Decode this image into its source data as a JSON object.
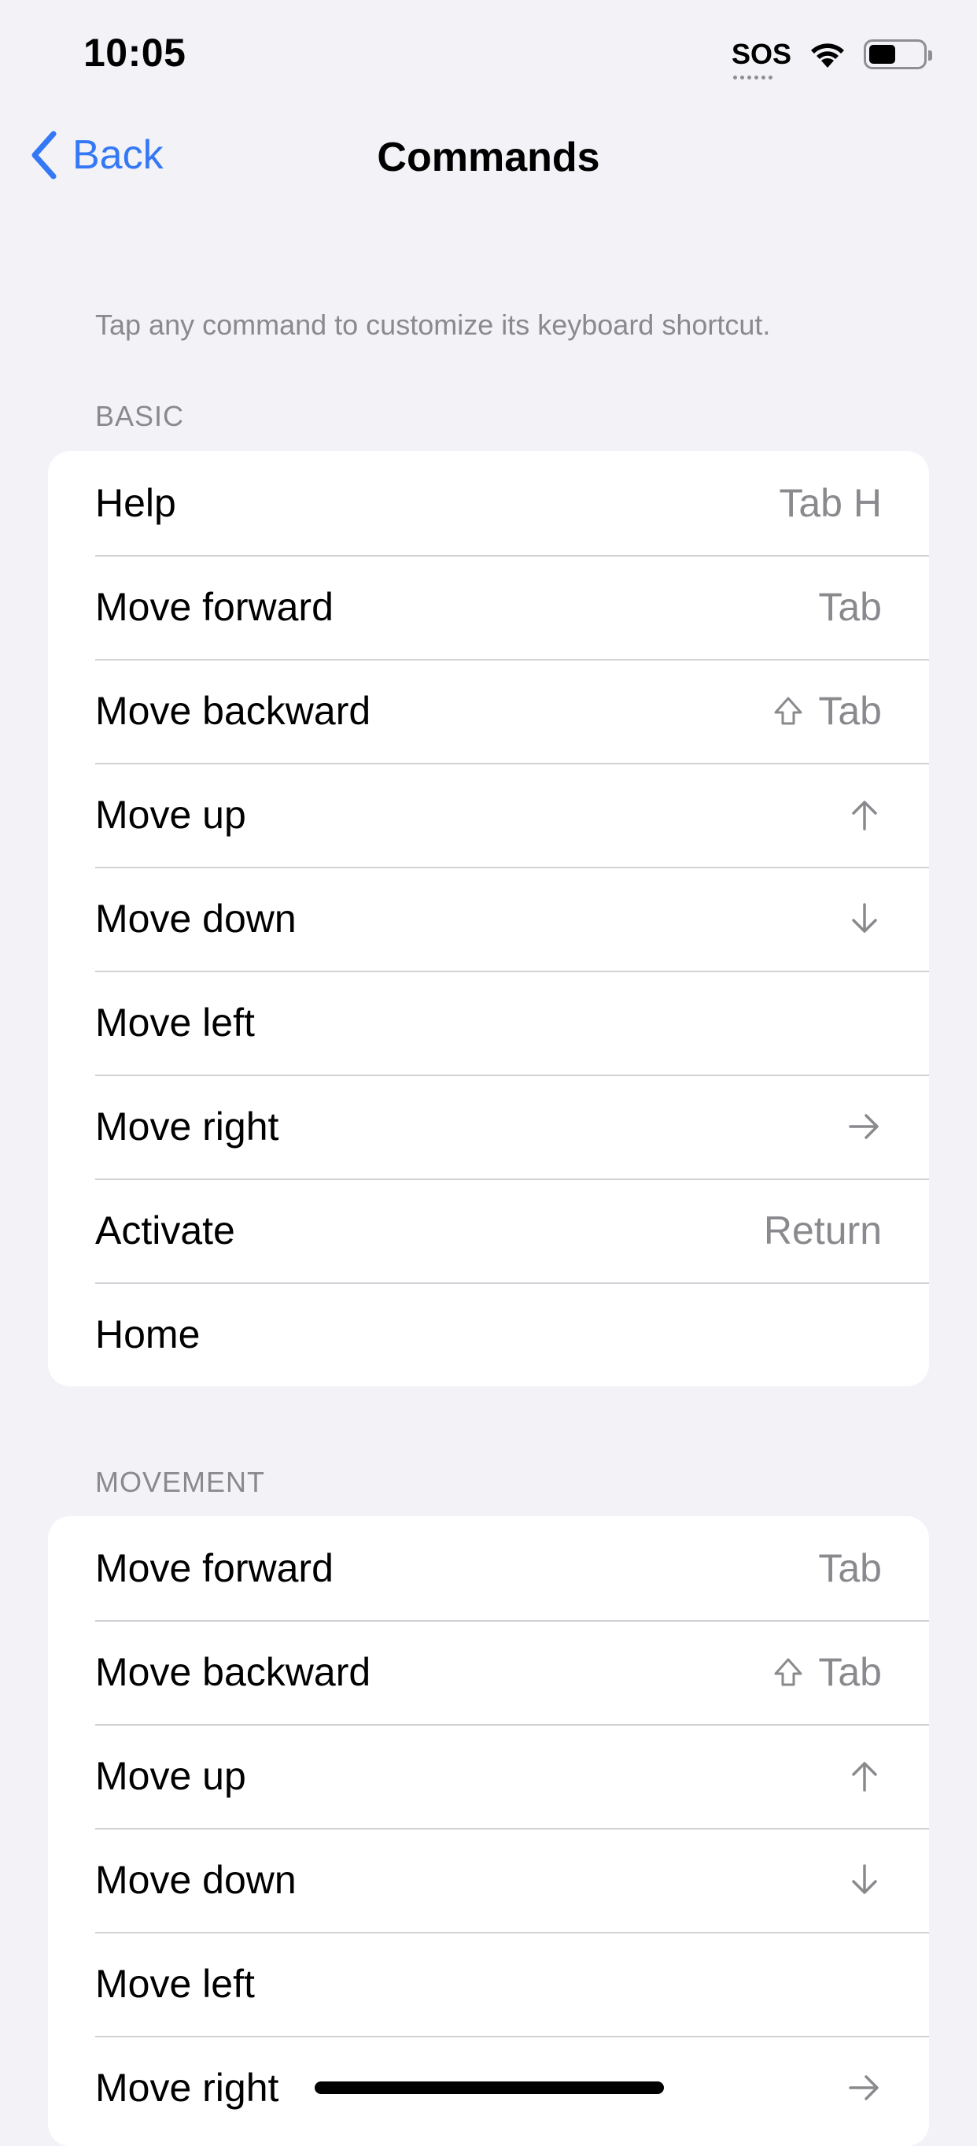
{
  "status_bar": {
    "time": "10:05",
    "sos_label": "SOS",
    "battery_level": 0.5
  },
  "nav": {
    "back_label": "Back",
    "title": "Commands"
  },
  "intro": "Tap any command to customize its keyboard shortcut.",
  "sections": [
    {
      "header": "BASIC",
      "items": [
        {
          "label": "Help",
          "shortcut": "Tab H",
          "icon": ""
        },
        {
          "label": "Move forward",
          "shortcut": "Tab",
          "icon": ""
        },
        {
          "label": "Move backward",
          "shortcut": "Tab",
          "icon": "shift-icon"
        },
        {
          "label": "Move up",
          "shortcut": "",
          "icon": "arrow-up-icon"
        },
        {
          "label": "Move down",
          "shortcut": "",
          "icon": "arrow-down-icon"
        },
        {
          "label": "Move left",
          "shortcut": "",
          "icon": ""
        },
        {
          "label": "Move right",
          "shortcut": "",
          "icon": "arrow-right-icon"
        },
        {
          "label": "Activate",
          "shortcut": "Return",
          "icon": ""
        },
        {
          "label": "Home",
          "shortcut": "",
          "icon": ""
        }
      ]
    },
    {
      "header": "MOVEMENT",
      "items": [
        {
          "label": "Move forward",
          "shortcut": "Tab",
          "icon": ""
        },
        {
          "label": "Move backward",
          "shortcut": "Tab",
          "icon": "shift-icon"
        },
        {
          "label": "Move up",
          "shortcut": "",
          "icon": "arrow-up-icon"
        },
        {
          "label": "Move down",
          "shortcut": "",
          "icon": "arrow-down-icon"
        },
        {
          "label": "Move left",
          "shortcut": "",
          "icon": ""
        },
        {
          "label": "Move right",
          "shortcut": "",
          "icon": "arrow-right-icon"
        }
      ]
    }
  ],
  "colors": {
    "accent": "#3478f6",
    "background": "#f2f2f7",
    "secondary_text": "#8a8a8e",
    "separator": "#d1d1d6"
  }
}
